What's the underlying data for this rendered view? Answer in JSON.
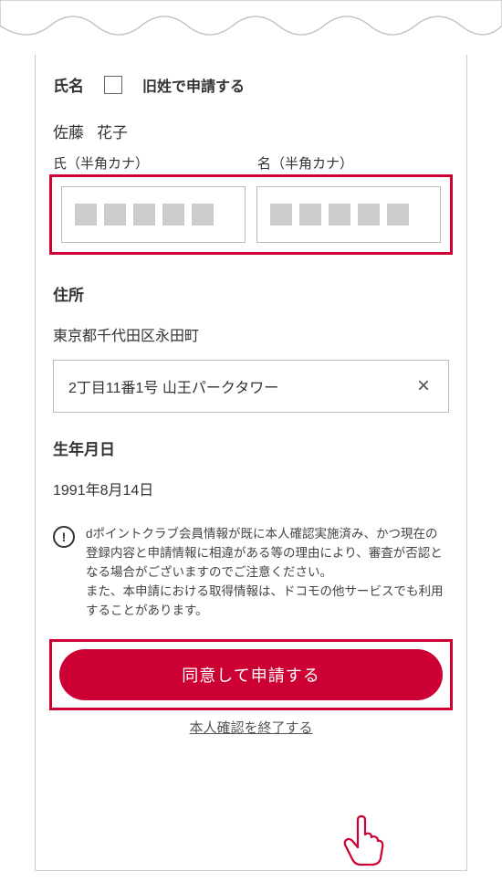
{
  "form": {
    "name_section_label": "氏名",
    "maiden_checkbox_label": "旧姓で申請する",
    "surname": "佐藤",
    "given_name": "花子",
    "kana_surname_label": "氏（半角カナ）",
    "kana_given_label": "名（半角カナ）",
    "address_section_label": "住所",
    "address_prefilled": "東京都千代田区永田町",
    "address_detail_value": "2丁目11番1号 山王パークタワー",
    "dob_section_label": "生年月日",
    "dob_value": "1991年8月14日",
    "alert_text": "dポイントクラブ会員情報が既に本人確認実施済み、かつ現在の登録内容と申請情報に相違がある等の理由により、審査が否認となる場合がございますのでご注意ください。\nまた、本申請における取得情報は、ドコモの他サービスでも利用することがあります。",
    "submit_label": "同意して申請する",
    "terminate_label": "本人確認を終了する"
  }
}
